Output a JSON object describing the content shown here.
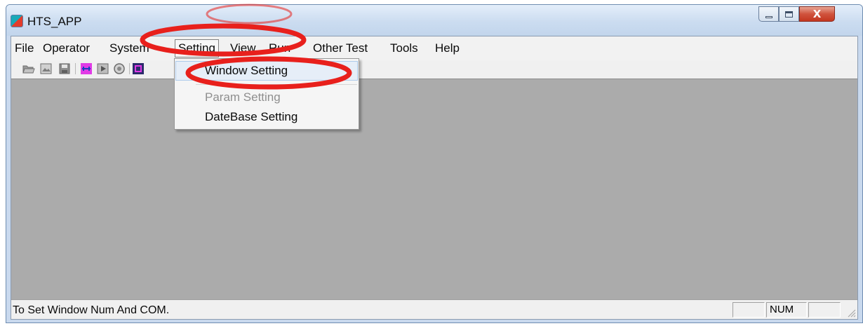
{
  "window": {
    "title": "HTS_APP",
    "close_glyph": "X"
  },
  "menu": {
    "items": [
      "File",
      "Operator",
      "System",
      "Setting",
      "View",
      "Run",
      "Other Test",
      "Tools",
      "Help"
    ],
    "open_index": 3
  },
  "toolbar": {
    "icons": [
      "open-folder-icon",
      "open-image-icon",
      "save-icon",
      "connect-icon",
      "play-icon",
      "stop-icon",
      "chip-icon"
    ]
  },
  "dropdown": {
    "items": [
      {
        "label": "Window Setting",
        "state": "highlighted"
      },
      {
        "label": "Param Setting",
        "state": "disabled"
      },
      {
        "label": "DateBase Setting",
        "state": "enabled"
      }
    ]
  },
  "statusbar": {
    "text": "To Set Window Num And COM.",
    "panes": [
      "",
      "NUM",
      ""
    ]
  },
  "colors": {
    "mdi_background": "#ababab",
    "annotation_red": "#e8201c",
    "connect_icon_magenta": "#e13be6"
  }
}
